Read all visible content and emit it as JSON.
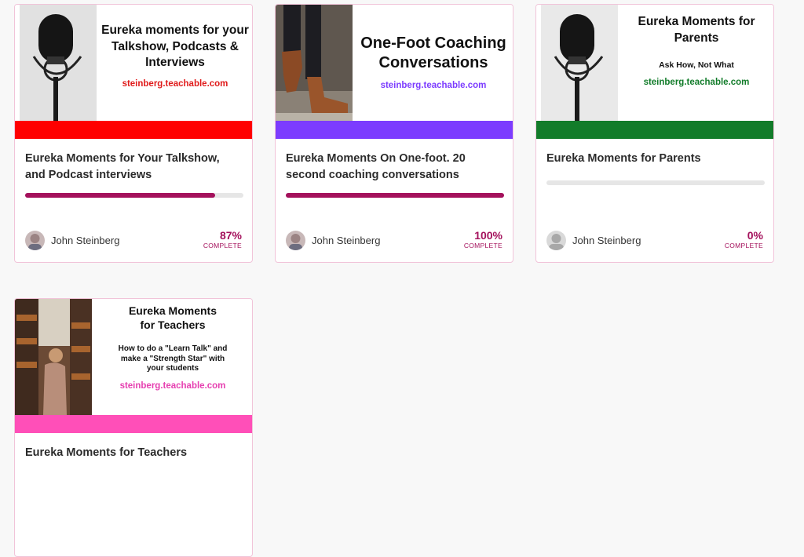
{
  "courses": [
    {
      "thumb_title": "Eureka moments for your Talkshow, Podcasts & Interviews",
      "thumb_subtitle": "",
      "thumb_url": "steinberg.teachable.com",
      "accent_color": "#ff0000",
      "title": "Eureka Moments for Your Talkshow, and Podcast interviews",
      "progress": 87,
      "percent_label": "87%",
      "complete_label": "COMPLETE",
      "author": "John Steinberg"
    },
    {
      "thumb_title": "One-Foot Coaching Conversations",
      "thumb_subtitle": "",
      "thumb_url": "steinberg.teachable.com",
      "accent_color": "#7c3cff",
      "title": "Eureka Moments On One-foot. 20 second coaching conversations",
      "progress": 100,
      "percent_label": "100%",
      "complete_label": "COMPLETE",
      "author": "John Steinberg"
    },
    {
      "thumb_title": "Eureka Moments for Parents",
      "thumb_subtitle": "Ask How, Not What",
      "thumb_url": "steinberg.teachable.com",
      "accent_color": "#127c2a",
      "title": "Eureka Moments for Parents",
      "progress": 0,
      "percent_label": "0%",
      "complete_label": "COMPLETE",
      "author": "John Steinberg"
    },
    {
      "thumb_title": "Eureka Moments for Teachers",
      "thumb_subtitle": "How to do a \"Learn Talk\" and make a \"Strength Star\" with your students",
      "thumb_url": "steinberg.teachable.com",
      "accent_color": "#ff4fb8",
      "title": "Eureka Moments for Teachers"
    }
  ]
}
